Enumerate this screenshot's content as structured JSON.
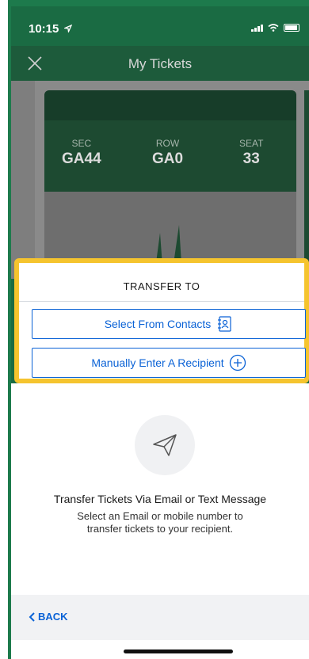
{
  "status_bar": {
    "time": "10:15"
  },
  "header": {
    "title": "My Tickets"
  },
  "ticket": {
    "sec_label": "SEC",
    "sec_value": "GA44",
    "row_label": "ROW",
    "row_value": "GA0",
    "seat_label": "SEAT",
    "seat_value": "33"
  },
  "transfer_modal": {
    "title": "TRANSFER TO",
    "select_contacts_label": "Select From Contacts",
    "manual_entry_label": "Manually Enter A Recipient"
  },
  "info": {
    "title": "Transfer Tickets Via Email or Text Message",
    "description": "Select an Email or mobile number to transfer tickets to your recipient."
  },
  "footer": {
    "back_label": "BACK"
  },
  "colors": {
    "accent": "#0a62d6",
    "highlight": "#f5c42e",
    "brand_green": "#1d7a4c"
  }
}
